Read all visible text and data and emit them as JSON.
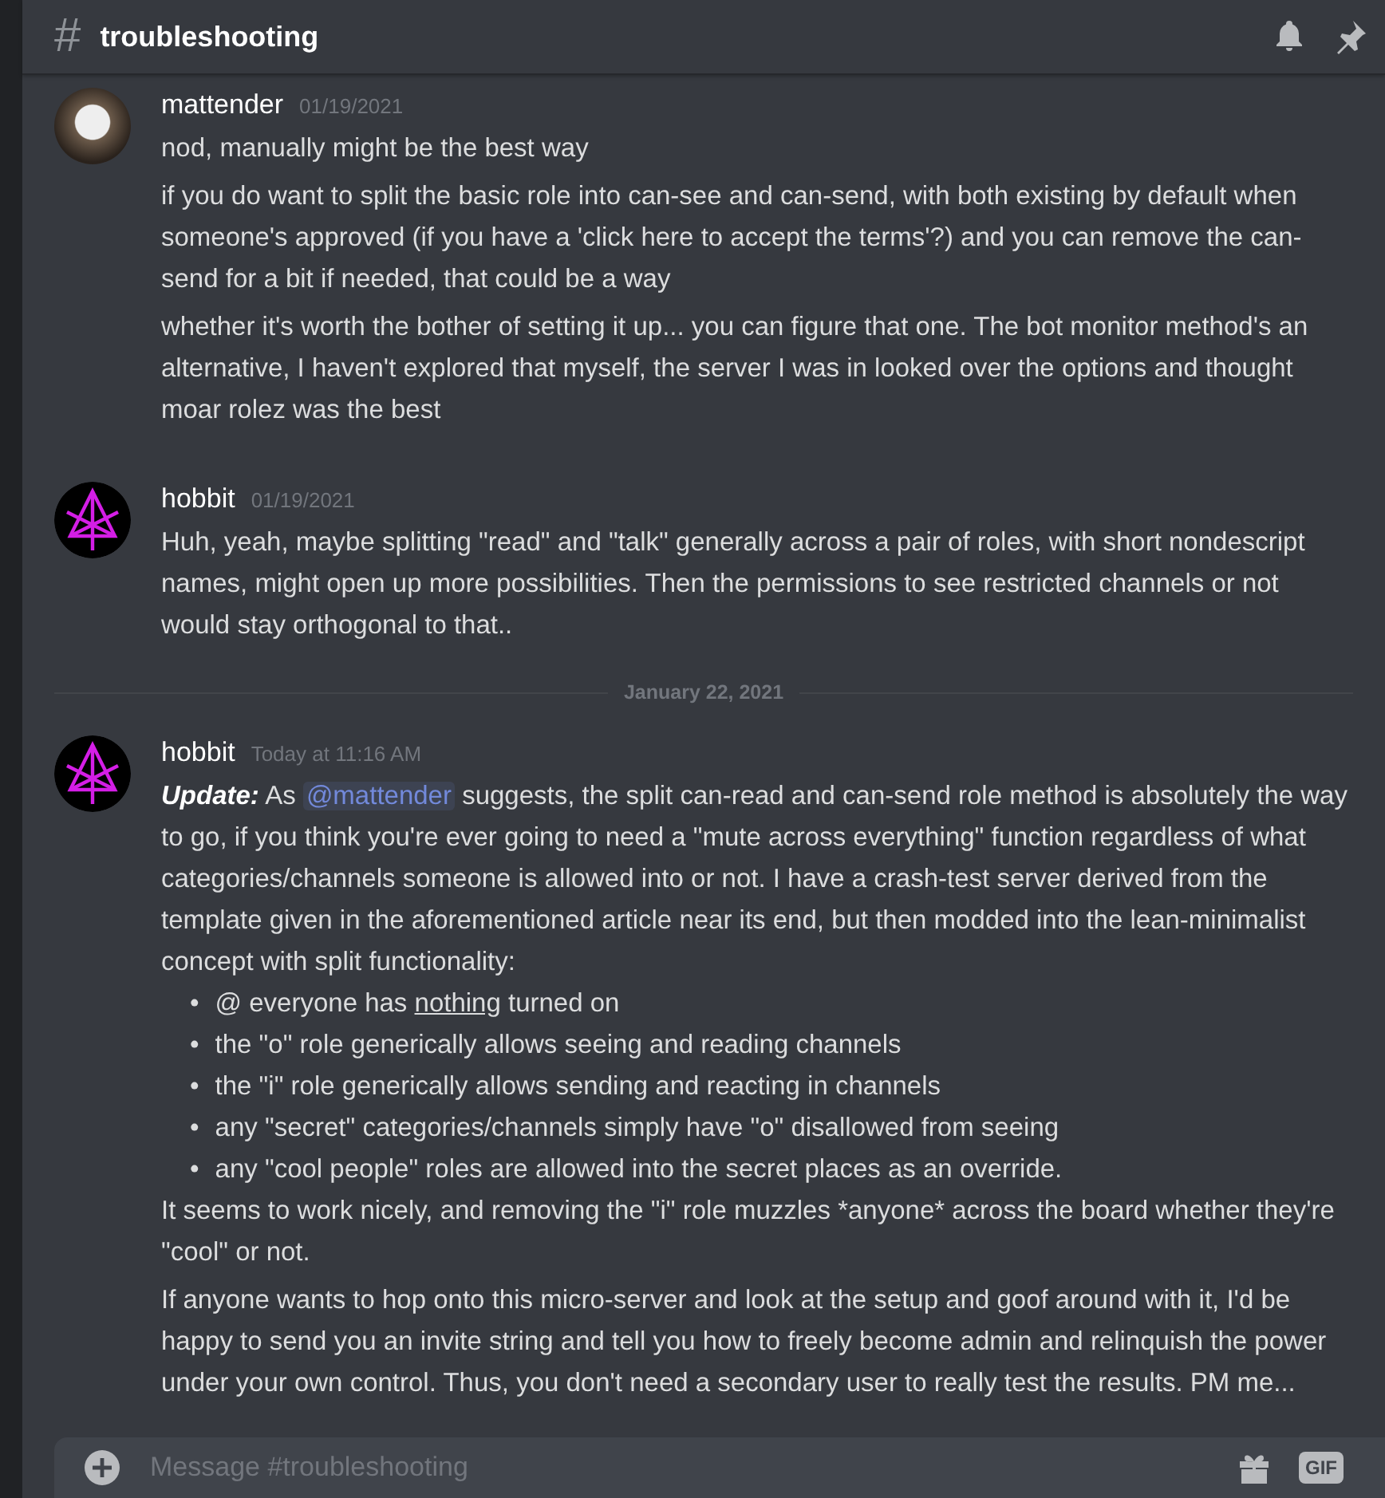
{
  "channel": {
    "hash": "#",
    "name": "troubleshooting"
  },
  "messages": [
    {
      "kind": "message",
      "author": "mattender",
      "time": "01/19/2021",
      "avatar": {
        "kind": "photo"
      },
      "paragraphs": [
        {
          "kind": "text",
          "parts": [
            {
              "kind": "text",
              "text": "nod, manually might be the best way"
            }
          ]
        },
        {
          "kind": "text",
          "parts": [
            {
              "kind": "text",
              "text": "if you do want to split the basic role into can-see and can-send, with both existing by default when someone's approved (if you have a 'click here to accept the terms'?) and you can remove the can-send for a bit if needed, that could be a way"
            }
          ]
        },
        {
          "kind": "text",
          "parts": [
            {
              "kind": "text",
              "text": "whether it's worth the bother of setting it up... you can figure that one.  The bot monitor method's an alternative, I haven't explored that myself, the server I was in looked over the options and thought moar rolez was the best"
            }
          ]
        }
      ]
    },
    {
      "kind": "message",
      "author": "hobbit",
      "time": "01/19/2021",
      "avatar": {
        "kind": "symbol"
      },
      "paragraphs": [
        {
          "kind": "text",
          "parts": [
            {
              "kind": "text",
              "text": "Huh, yeah, maybe splitting \"read\" and \"talk\" generally across a pair of roles, with short nondescript names, might open up more possibilities.  Then the permissions to see restricted channels or not would stay orthogonal to that.."
            }
          ]
        }
      ]
    },
    {
      "kind": "divider",
      "date": "January 22, 2021"
    },
    {
      "kind": "message",
      "author": "hobbit",
      "time": "Today at 11:16 AM",
      "avatar": {
        "kind": "symbol"
      },
      "paragraphs": [
        {
          "kind": "text",
          "parts": [
            {
              "kind": "label",
              "text": "Update:"
            },
            {
              "kind": "text",
              "text": "  As "
            },
            {
              "kind": "mention",
              "text": "@mattender"
            },
            {
              "kind": "text",
              "text": " suggests, the split can-read and can-send role method is absolutely the way to go, if you think you're ever going to need a \"mute across everything\" function regardless of what categories/channels someone is allowed into or not.  I have a crash-test server derived from the template given in the aforementioned article near its end, but then modded into the lean-minimalist concept with split functionality:"
            }
          ]
        },
        {
          "kind": "list",
          "items": [
            {
              "marker": "•",
              "parts": [
                {
                  "kind": "text",
                  "text": "@ everyone has "
                },
                {
                  "kind": "underline",
                  "text": "nothing"
                },
                {
                  "kind": "text",
                  "text": " turned on"
                }
              ]
            },
            {
              "marker": "•",
              "parts": [
                {
                  "kind": "text",
                  "text": "the \"o\" role generically allows seeing and reading channels"
                }
              ]
            },
            {
              "marker": "•",
              "parts": [
                {
                  "kind": "text",
                  "text": "the \"i\" role generically allows sending and reacting in channels"
                }
              ]
            },
            {
              "marker": "•",
              "parts": [
                {
                  "kind": "text",
                  "text": "any \"secret\" categories/channels simply have \"o\" disallowed from seeing"
                }
              ]
            },
            {
              "marker": "•",
              "parts": [
                {
                  "kind": "text",
                  "text": "any \"cool people\" roles are allowed into the secret places as an override."
                }
              ]
            }
          ]
        },
        {
          "kind": "tight",
          "parts": [
            {
              "kind": "text",
              "text": "It seems to work nicely, and removing the \"i\" role muzzles *anyone* across  the board whether they're \"cool\" or not."
            }
          ]
        },
        {
          "kind": "text",
          "parts": [
            {
              "kind": "text",
              "text": "If anyone wants to hop onto this micro-server and look at the setup and goof around with it, I'd be happy to send you an invite string and tell you how to freely become admin and relinquish the power under your own control.  Thus, you don't need a secondary user to really test the results.  PM me..."
            }
          ]
        }
      ]
    }
  ],
  "composer": {
    "placeholder": "Message #troubleshooting",
    "gif": "GIF"
  }
}
